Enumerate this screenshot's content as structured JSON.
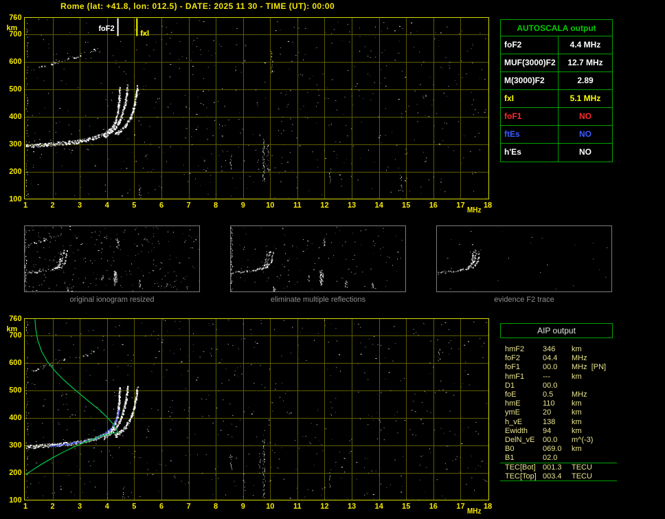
{
  "title": "Rome (lat: +41.8, lon: 012.5) - DATE: 2025 11 30 - TIME (UT): 00:00",
  "colors": {
    "axis_yellow": "#f0e400",
    "grid_dim_yellow": "#5c5c00",
    "plot_border_yellow": "#d8d800",
    "table_green": "#00a400",
    "header_green": "#00cc00",
    "trace_white": "#ffffff",
    "profile_green": "#00bb44",
    "restored_blue": "#3c50ff",
    "caption_gray": "#8f8f8f",
    "aip_text": "#e8e48e"
  },
  "autoscala": {
    "header": "AUTOSCALA output",
    "rows": [
      {
        "param": "foF2",
        "value": "4.4 MHz",
        "color": "#ffffff"
      },
      {
        "param": "MUF(3000)F2",
        "value": "12.7 MHz",
        "color": "#ffffff"
      },
      {
        "param": "M(3000)F2",
        "value": "2.89",
        "color": "#ffffff"
      },
      {
        "param": "fxI",
        "value": "5.1 MHz",
        "color": "#ffff00"
      },
      {
        "param": "foF1",
        "value": "NO",
        "color": "#ff2a2a"
      },
      {
        "param": "ftEs",
        "value": "NO",
        "color": "#3a5bff"
      },
      {
        "param": "h'Es",
        "value": "NO",
        "color": "#ffffff"
      }
    ]
  },
  "aip": {
    "header": "AIP output",
    "rows": [
      {
        "param": "hmF2",
        "value": "346",
        "unit": "km"
      },
      {
        "param": "foF2",
        "value": "04.4",
        "unit": "MHz"
      },
      {
        "param": "foF1",
        "value": "00.0",
        "unit": "MHz  [PN]"
      },
      {
        "param": "hmF1",
        "value": "---",
        "unit": "km"
      },
      {
        "param": "D1",
        "value": "00.0",
        "unit": ""
      },
      {
        "param": "foE",
        "value": "0.5",
        "unit": "MHz"
      },
      {
        "param": "hmE",
        "value": "110",
        "unit": "km"
      },
      {
        "param": "ymE",
        "value": "20",
        "unit": "km"
      },
      {
        "param": "h_vE",
        "value": "138",
        "unit": "km"
      },
      {
        "param": "Ewidth",
        "value": "94",
        "unit": "km"
      },
      {
        "param": "DelN_vE",
        "value": "00.0",
        "unit": "m^(-3)"
      },
      {
        "param": "B0",
        "value": "069.0",
        "unit": "km"
      },
      {
        "param": "B1",
        "value": "02.0",
        "unit": ""
      },
      {
        "param": "TEC[Bot]",
        "value": "001.3",
        "unit": "TECU",
        "sep_top": true
      },
      {
        "param": "TEC[Top]",
        "value": "003.4",
        "unit": "TECU",
        "sep_bottom": true
      }
    ]
  },
  "chart_data": [
    {
      "name": "main_ionogram",
      "type": "scatter",
      "title": "recorded ionogram with autoscaled characteristics",
      "xlabel": "MHz",
      "ylabel": "km",
      "xlim": [
        1,
        18
      ],
      "ylim": [
        100,
        760
      ],
      "x_ticks": [
        1,
        2,
        3,
        4,
        5,
        6,
        7,
        8,
        9,
        10,
        11,
        12,
        13,
        14,
        15,
        16,
        17,
        18
      ],
      "y_ticks": [
        760,
        700,
        600,
        500,
        400,
        300,
        200,
        100
      ],
      "grid": true,
      "markers": [
        {
          "label": "foF2",
          "x": 4.4,
          "color": "#ffffff"
        },
        {
          "label": "fxI",
          "x": 5.1,
          "color": "#ffff00"
        }
      ],
      "series": [
        {
          "name": "f2-trace-ordinary",
          "points": [
            [
              1.0,
              294
            ],
            [
              1.4,
              297
            ],
            [
              1.8,
              300
            ],
            [
              2.2,
              303
            ],
            [
              2.6,
              307
            ],
            [
              3.0,
              312
            ],
            [
              3.3,
              318
            ],
            [
              3.6,
              326
            ],
            [
              3.85,
              336
            ],
            [
              4.05,
              348
            ],
            [
              4.2,
              364
            ],
            [
              4.3,
              384
            ],
            [
              4.37,
              408
            ],
            [
              4.41,
              438
            ],
            [
              4.44,
              472
            ],
            [
              4.46,
              505
            ]
          ]
        },
        {
          "name": "f2-trace-mid",
          "points": [
            [
              3.9,
              330
            ],
            [
              4.1,
              344
            ],
            [
              4.28,
              360
            ],
            [
              4.42,
              380
            ],
            [
              4.52,
              402
            ],
            [
              4.6,
              428
            ],
            [
              4.67,
              458
            ],
            [
              4.72,
              492
            ],
            [
              4.75,
              512
            ]
          ]
        },
        {
          "name": "f2-trace-extraordinary",
          "points": [
            [
              4.3,
              336
            ],
            [
              4.5,
              350
            ],
            [
              4.68,
              368
            ],
            [
              4.82,
              390
            ],
            [
              4.93,
              415
            ],
            [
              5.0,
              444
            ],
            [
              5.06,
              476
            ],
            [
              5.1,
              508
            ]
          ]
        },
        {
          "name": "second-hop-trace",
          "sparse": true,
          "points": [
            [
              1.25,
              572
            ],
            [
              1.6,
              584
            ],
            [
              2.0,
              597
            ],
            [
              2.4,
              608
            ],
            [
              2.8,
              619
            ],
            [
              3.2,
              631
            ],
            [
              3.5,
              642
            ],
            [
              3.7,
              652
            ]
          ]
        }
      ],
      "noise": {
        "seed": 77,
        "count": 620,
        "strips": [
          [
            1.05,
            110,
            750,
            10
          ],
          [
            9.75,
            165,
            320,
            3
          ],
          [
            9.9,
            205,
            300,
            4
          ],
          [
            8.55,
            210,
            268,
            5
          ],
          [
            12.2,
            150,
            212,
            5
          ],
          [
            5.2,
            102,
            150,
            4
          ],
          [
            14.8,
            140,
            190,
            6
          ],
          [
            10.05,
            560,
            640,
            6
          ]
        ]
      }
    },
    {
      "name": "profile_ionogram",
      "type": "scatter",
      "title": "ionogram with restored trace and electron density profile",
      "xlabel": "MHz",
      "ylabel": "km",
      "xlim": [
        1,
        18
      ],
      "ylim": [
        100,
        760
      ],
      "x_ticks": [
        1,
        2,
        3,
        4,
        5,
        6,
        7,
        8,
        9,
        10,
        11,
        12,
        13,
        14,
        15,
        16,
        17,
        18
      ],
      "y_ticks": [
        760,
        700,
        600,
        500,
        400,
        300,
        200,
        100
      ],
      "grid": true,
      "series_from": "main_ionogram",
      "profile": {
        "color": "#00bb44",
        "bottomside": [
          [
            1.0,
            192
          ],
          [
            1.3,
            212
          ],
          [
            1.6,
            231
          ],
          [
            2.0,
            254
          ],
          [
            2.4,
            275
          ],
          [
            2.8,
            294
          ],
          [
            3.2,
            311
          ],
          [
            3.6,
            326
          ],
          [
            3.9,
            336
          ],
          [
            4.15,
            342
          ],
          [
            4.4,
            346
          ]
        ],
        "topside": [
          [
            4.4,
            346
          ],
          [
            4.32,
            362
          ],
          [
            4.18,
            382
          ],
          [
            3.98,
            404
          ],
          [
            3.72,
            428
          ],
          [
            3.42,
            452
          ],
          [
            3.1,
            478
          ],
          [
            2.76,
            506
          ],
          [
            2.42,
            536
          ],
          [
            2.1,
            568
          ],
          [
            1.82,
            602
          ],
          [
            1.6,
            640
          ],
          [
            1.45,
            682
          ],
          [
            1.38,
            722
          ],
          [
            1.35,
            760
          ]
        ]
      },
      "restored_trace": {
        "color": "#3c50ff",
        "points": [
          [
            1.9,
            296
          ],
          [
            2.2,
            300
          ],
          [
            2.5,
            304
          ],
          [
            2.8,
            309
          ],
          [
            3.1,
            315
          ],
          [
            3.35,
            321
          ],
          [
            3.6,
            328
          ],
          [
            3.8,
            337
          ],
          [
            3.95,
            346
          ],
          [
            4.1,
            358
          ],
          [
            4.2,
            372
          ],
          [
            4.3,
            390
          ],
          [
            4.37,
            410
          ],
          [
            4.42,
            430
          ]
        ]
      },
      "noise": {
        "seed": 99,
        "count": 620,
        "strips": [
          [
            1.05,
            110,
            750,
            10
          ],
          [
            9.75,
            110,
            320,
            3
          ],
          [
            9.6,
            200,
            280,
            5
          ],
          [
            8.55,
            215,
            265,
            5
          ],
          [
            4.6,
            105,
            150,
            4
          ],
          [
            12.2,
            150,
            200,
            5
          ],
          [
            16.2,
            610,
            650,
            5
          ]
        ]
      }
    },
    {
      "name": "thumb_original",
      "type": "scatter",
      "caption": "original ionogram resized",
      "series_from": "main_ionogram",
      "include_second_hop": true,
      "use_strips": true,
      "noise": {
        "seed": 11,
        "count": 260
      }
    },
    {
      "name": "thumb_cleaned",
      "type": "scatter",
      "caption": "eliminate multiple reflections",
      "series_from": "main_ionogram",
      "include_second_hop": false,
      "use_strips": true,
      "noise": {
        "seed": 12,
        "count": 120
      }
    },
    {
      "name": "thumb_f2",
      "type": "scatter",
      "caption": "evidence F2 trace",
      "series_from": "main_ionogram",
      "include_second_hop": false,
      "use_strips": false,
      "noise": {
        "seed": 13,
        "count": 30
      }
    }
  ]
}
